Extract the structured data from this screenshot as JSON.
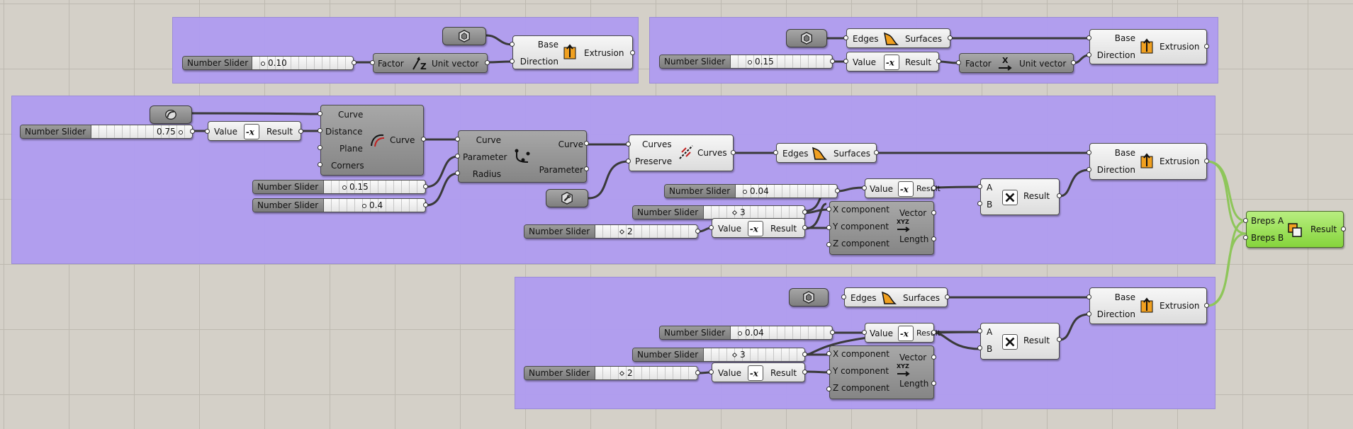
{
  "groups": [
    {
      "name": "group-top-left",
      "label": ""
    },
    {
      "name": "group-top-right",
      "label": ""
    },
    {
      "name": "group-middle",
      "label": ""
    },
    {
      "name": "group-bottom",
      "label": ""
    }
  ],
  "sliders": {
    "s1": {
      "name": "Number Slider",
      "value": "0.10"
    },
    "s2": {
      "name": "Number Slider",
      "value": "0.15"
    },
    "s3": {
      "name": "Number Slider",
      "value": "0.75"
    },
    "s4": {
      "name": "Number Slider",
      "value": "0.15"
    },
    "s5": {
      "name": "Number Slider",
      "value": "0.4"
    },
    "s6": {
      "name": "Number Slider",
      "value": "0.04"
    },
    "s7": {
      "name": "Number Slider",
      "value": "3"
    },
    "s8": {
      "name": "Number Slider",
      "value": "2"
    },
    "s9": {
      "name": "Number Slider",
      "value": "0.04"
    },
    "s10": {
      "name": "Number Slider",
      "value": "3"
    },
    "s11": {
      "name": "Number Slider",
      "value": "2"
    }
  },
  "components": {
    "unit_z": {
      "in": "Factor",
      "out": "Unit vector"
    },
    "unit_x": {
      "in": "Factor",
      "out": "Unit vector"
    },
    "extrusion": {
      "in1": "Base",
      "in2": "Direction",
      "out": "Extrusion"
    },
    "edge_surf": {
      "in": "Edges",
      "out": "Surfaces"
    },
    "negative": {
      "in": "Value",
      "out": "Result"
    },
    "offset": {
      "in1": "Curve",
      "in2": "Distance",
      "in3": "Plane",
      "in4": "Corners",
      "out": "Curve"
    },
    "fillet": {
      "in1": "Curve",
      "in2": "Parameter",
      "in3": "Radius",
      "out1": "Curve",
      "out2": "Parameter"
    },
    "join": {
      "in1": "Curves",
      "in2": "Preserve",
      "out": "Curves"
    },
    "multiply": {
      "in1": "A",
      "in2": "B",
      "out": "Result"
    },
    "vector_xyz": {
      "in1": "X component",
      "in2": "Y component",
      "in3": "Z component",
      "out1": "Vector",
      "out2": "Length"
    },
    "boolean": {
      "in1": "Breps A",
      "in2": "Breps B",
      "out": "Result"
    }
  },
  "colors": {
    "canvas": "#d4d0c8",
    "group": "#b09df0",
    "wire": "#3a3a3a",
    "wire_green": "#8ec65a",
    "boolean_component": "#98e050",
    "extrusion_icon": "#f0a020"
  }
}
